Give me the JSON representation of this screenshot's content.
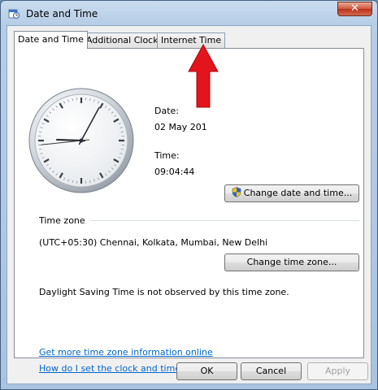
{
  "window": {
    "title": "Date and Time",
    "close_glyph": "✕",
    "icon": "clock-icon"
  },
  "tabs": [
    {
      "label": "Date and Time",
      "active": true
    },
    {
      "label": "Additional Clocks",
      "active": false
    },
    {
      "label": "Internet Time",
      "active": false
    }
  ],
  "clock": {
    "hour": 9,
    "minute": 4,
    "second": 44
  },
  "date": {
    "label": "Date:",
    "value": "02 May 201"
  },
  "time": {
    "label": "Time:",
    "value": "09:04:44"
  },
  "buttons": {
    "change_date_time": "Change date and time...",
    "change_time_zone": "Change time zone...",
    "ok": "OK",
    "cancel": "Cancel",
    "apply": "Apply"
  },
  "timezone": {
    "heading": "Time zone",
    "value": "(UTC+05:30) Chennai, Kolkata, Mumbai, New Delhi",
    "dst_note": "Daylight Saving Time is not observed by this time zone."
  },
  "links": {
    "more_info": "Get more time zone information online",
    "how_to": "How do I set the clock and time zone?"
  },
  "annotation": {
    "arrow_color": "#e3141b",
    "points_to": "Internet Time"
  }
}
